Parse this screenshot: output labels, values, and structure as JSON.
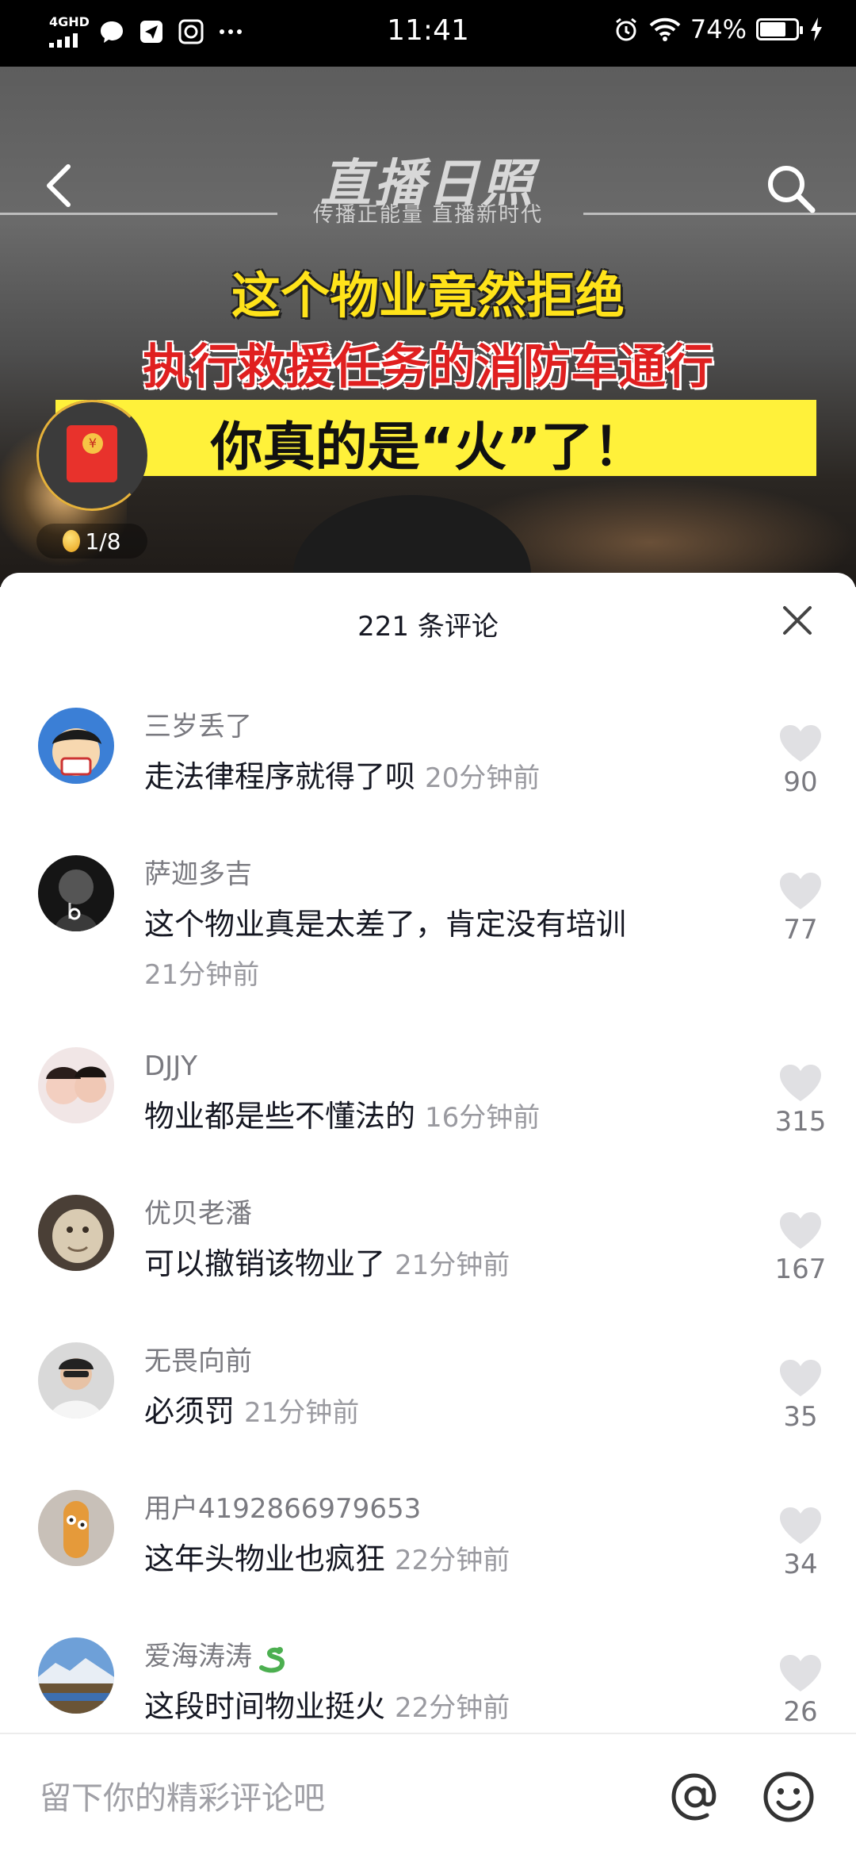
{
  "status_bar": {
    "network": "4GHD",
    "time": "11:41",
    "battery_percent": "74%",
    "battery_level": 0.74
  },
  "video": {
    "watermark_title": "直播日照",
    "watermark_subtitle": "传播正能量 直播新时代",
    "caption_line1": "这个物业竟然拒绝",
    "caption_line2": "执行救援任务的消防车通行",
    "caption_line3": "你真的是“火”了！",
    "red_packet_count": "1/8"
  },
  "comments_panel": {
    "title": "221 条评论",
    "comments": [
      {
        "user": "三岁丢了",
        "text": "走法律程序就得了呗",
        "time": "20分钟前",
        "likes": "90"
      },
      {
        "user": "萨迦多吉",
        "text": "这个物业真是太差了，肯定没有培训",
        "time": "21分钟前",
        "likes": "77"
      },
      {
        "user": "DJJY",
        "text": "物业都是些不懂法的",
        "time": "16分钟前",
        "likes": "315"
      },
      {
        "user": "优贝老潘",
        "text": "可以撤销该物业了",
        "time": "21分钟前",
        "likes": "167"
      },
      {
        "user": "无畏向前",
        "text": "必须罚",
        "time": "21分钟前",
        "likes": "35"
      },
      {
        "user": "用户4192866979653",
        "text": "这年头物业也疯狂",
        "time": "22分钟前",
        "likes": "34"
      },
      {
        "user": "爱海涛涛",
        "text": "这段时间物业挺火",
        "time": "22分钟前",
        "likes": "26"
      }
    ]
  },
  "input": {
    "placeholder": "留下你的精彩评论吧"
  },
  "colors": {
    "like_icon": "#e0e0e3",
    "caption_yellow": "#ffe31a",
    "caption_red": "#e02020"
  }
}
